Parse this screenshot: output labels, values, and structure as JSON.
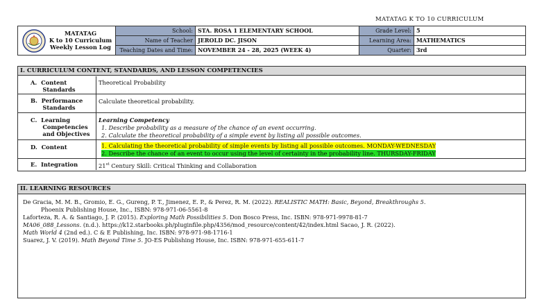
{
  "top_right": "MATATAG K TO 10 CURRICULUM",
  "header": {
    "title_lines": [
      "MATATAG",
      "K to 10 Curriculum",
      "Weekly Lesson Log"
    ],
    "school_label": "School:",
    "school": "STA. ROSA 1 ELEMENTARY SCHOOL",
    "grade_label": "Grade Level:",
    "grade": "5",
    "teacher_label": "Name of Teacher",
    "teacher": "JEROLD DC. JISON",
    "area_label": "Learning Area:",
    "area": "MATHEMATICS",
    "dates_label": "Teaching Dates and Time:",
    "dates": "NOVEMBER 24 - 28, 2025 (WEEK 4)",
    "quarter_label": "Quarter:",
    "quarter": "3rd"
  },
  "section1": {
    "title": "I.   CURRICULUM CONTENT, STANDARDS, AND LESSON COMPETENCIES",
    "rows": {
      "a_label": "A.  Content\n      Standards",
      "a_value": "Theoretical Probability",
      "b_label": "B.  Performance\n      Standards",
      "b_value": "Calculate theoretical probability.",
      "c_label": "C.  Learning\n      Competencies\n      and Objectives",
      "c_heading": "Learning Competency",
      "c_item1": "1.   Describe probability as a measure of the chance of an event occurring.",
      "c_item2": "2.   Calculate the theoretical probability of a simple event by listing all possible outcomes.",
      "d_label": "D.  Content",
      "d_item1": "1.   Calculating the theoretical probability of simple events by listing all possible outcomes. MONDAY-WEDNESDAY",
      "d_item2": "2.   Describe the chance of an event to occur using the level of certainty in the probability line. THURSDAY-FRIDAY",
      "e_label": "E.  Integration",
      "e_value_a": "21",
      "e_value_sup": "st",
      "e_value_b": " Century Skill: Critical Thinking and Collaboration"
    }
  },
  "section2": {
    "title": "II. LEARNING RESOURCES",
    "ref1a": "De Gracia, M. M. B., Gromio, E. G., Gureng, P. T., Jimenez, E. P., & Perez, R. M. (2022). ",
    "ref1b": "REALISTIC MATH: Basic, Beyond, Breakthroughs 5.",
    "ref1c": "Phoenix Publishing House, Inc., ISBN: 978-971-06-5561-8",
    "ref2a": "Laforteza, R. A. & Santiago, J. P. (2015). ",
    "ref2b": "Exploring Math Possibilities 5.",
    "ref2c": " Don Bosco Press, Inc. ISBN: 978-971-9978-81-7",
    "ref3a": "MA06_088_Lessons",
    "ref3b": ". (n.d.). https://k12.starbooks.ph/pluginfile.php/4356/mod_resource/content/42/index.html  Sacao, J. R. (2022).",
    "ref4a": "Math World 4",
    "ref4b": " (2nd ed.). C & E Publishing, Inc. ISBN: 978-971-98-1716-1",
    "ref5a": "Suarez, J. V. (2019). ",
    "ref5b": "Math Beyond Time 5.",
    "ref5c": " JO-ES Publishing House, Inc. ISBN: 978-971-655-611-7"
  }
}
